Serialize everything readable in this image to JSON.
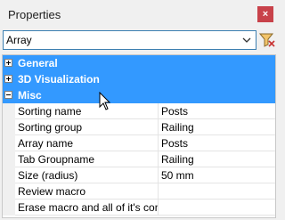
{
  "window": {
    "title": "Properties",
    "close_glyph": "×"
  },
  "selector": {
    "value": "Array",
    "filter_icon": "filter-icon"
  },
  "categories": [
    {
      "label": "General",
      "state": "collapsed"
    },
    {
      "label": "3D Visualization",
      "state": "collapsed"
    },
    {
      "label": "Misc",
      "state": "expanded"
    }
  ],
  "properties": [
    {
      "name": "Sorting name",
      "value": "Posts"
    },
    {
      "name": "Sorting group",
      "value": "Railing"
    },
    {
      "name": "Array name",
      "value": "Posts"
    },
    {
      "name": "Tab Groupname",
      "value": "Railing"
    },
    {
      "name": "Size (radius)",
      "value": "50 mm"
    },
    {
      "name": "Review macro",
      "value": ""
    },
    {
      "name": "Erase macro and all of it's compo",
      "value": ""
    }
  ],
  "colors": {
    "selection": "#3399ff",
    "close": "#c8424a",
    "focus_border": "#3c7fb1"
  }
}
